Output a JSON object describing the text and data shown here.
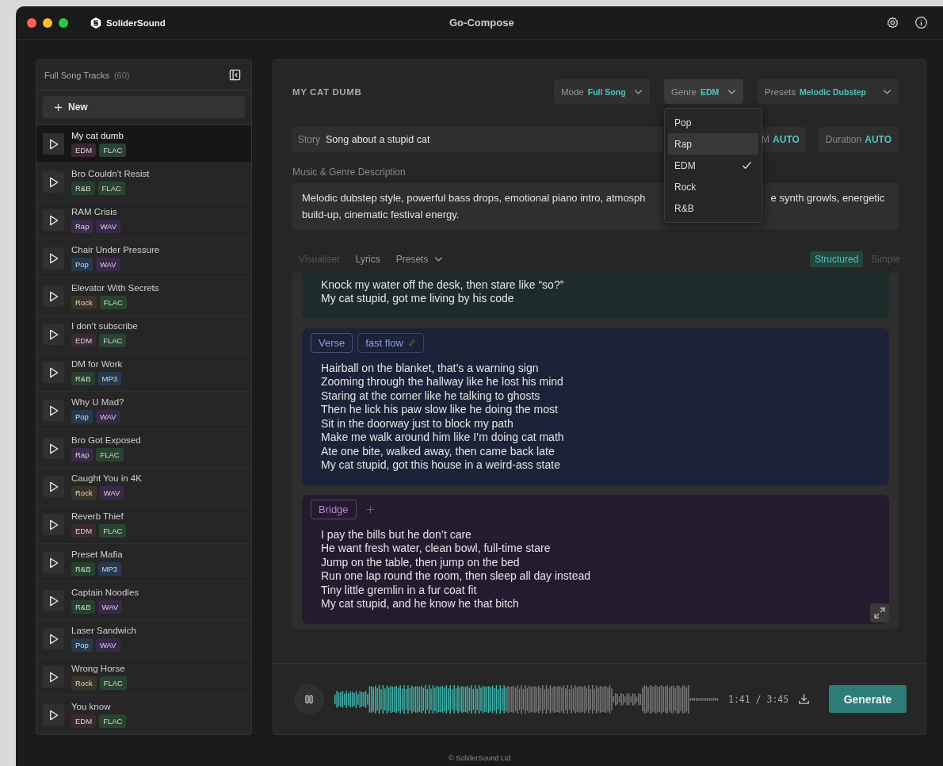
{
  "window": {
    "brand": "SoliderSound",
    "title": "Go-Compose"
  },
  "sidebar": {
    "title": "Full Song Tracks",
    "count": "(60)",
    "new_button": "New",
    "tracks": [
      {
        "name": "My cat dumb",
        "selected": true,
        "tags": [
          {
            "label": "EDM",
            "color": "#3a2833"
          },
          {
            "label": "FLAC",
            "color": "#284430"
          }
        ]
      },
      {
        "name": "Bro Couldn’t Resist",
        "selected": false,
        "tags": [
          {
            "label": "R&B",
            "color": "#27402e"
          },
          {
            "label": "FLAC",
            "color": "#284430"
          }
        ]
      },
      {
        "name": "RAM Crisis",
        "selected": false,
        "tags": [
          {
            "label": "Rap",
            "color": "#3a2b4b"
          },
          {
            "label": "WAV",
            "color": "#38294a"
          }
        ]
      },
      {
        "name": "Chair Under Pressure",
        "selected": false,
        "tags": [
          {
            "label": "Pop",
            "color": "#263a4f"
          },
          {
            "label": "WAV",
            "color": "#38294a"
          }
        ]
      },
      {
        "name": "Elevator With Secrets",
        "selected": false,
        "tags": [
          {
            "label": "Rock",
            "color": "#3a3427"
          },
          {
            "label": "FLAC",
            "color": "#284430"
          }
        ]
      },
      {
        "name": "I don’t subscribe",
        "selected": false,
        "tags": [
          {
            "label": "EDM",
            "color": "#3a2833"
          },
          {
            "label": "FLAC",
            "color": "#284430"
          }
        ]
      },
      {
        "name": "DM for Work",
        "selected": false,
        "tags": [
          {
            "label": "R&B",
            "color": "#27402e"
          },
          {
            "label": "MP3",
            "color": "#263a4f"
          }
        ]
      },
      {
        "name": "Why U Mad?",
        "selected": false,
        "tags": [
          {
            "label": "Pop",
            "color": "#263a4f"
          },
          {
            "label": "WAV",
            "color": "#38294a"
          }
        ]
      },
      {
        "name": "Bro Got Exposed",
        "selected": false,
        "tags": [
          {
            "label": "Rap",
            "color": "#3a2b4b"
          },
          {
            "label": "FLAC",
            "color": "#284430"
          }
        ]
      },
      {
        "name": "Caught You in 4K",
        "selected": false,
        "tags": [
          {
            "label": "Rock",
            "color": "#3a3427"
          },
          {
            "label": "WAV",
            "color": "#38294a"
          }
        ]
      },
      {
        "name": "Reverb Thief",
        "selected": false,
        "tags": [
          {
            "label": "EDM",
            "color": "#3a2833"
          },
          {
            "label": "FLAC",
            "color": "#284430"
          }
        ]
      },
      {
        "name": "Preset Mafia",
        "selected": false,
        "tags": [
          {
            "label": "R&B",
            "color": "#27402e"
          },
          {
            "label": "MP3",
            "color": "#263a4f"
          }
        ]
      },
      {
        "name": "Captain Noodles",
        "selected": false,
        "tags": [
          {
            "label": "R&B",
            "color": "#27402e"
          },
          {
            "label": "WAV",
            "color": "#38294a"
          }
        ]
      },
      {
        "name": "Laser Sandwich",
        "selected": false,
        "tags": [
          {
            "label": "Pop",
            "color": "#263a4f"
          },
          {
            "label": "WAV",
            "color": "#38294a"
          }
        ]
      },
      {
        "name": "Wrong Horse",
        "selected": false,
        "tags": [
          {
            "label": "Rock",
            "color": "#3a3427"
          },
          {
            "label": "FLAC",
            "color": "#284430"
          }
        ]
      },
      {
        "name": "You know",
        "selected": false,
        "tags": [
          {
            "label": "EDM",
            "color": "#3a2833"
          },
          {
            "label": "FLAC",
            "color": "#284430"
          }
        ]
      }
    ]
  },
  "composer": {
    "title": "MY CAT DUMB",
    "selectors": [
      {
        "label": "Mode",
        "value": "Full Song"
      },
      {
        "label": "Genre",
        "value": "EDM",
        "open": true,
        "options": [
          {
            "label": "Pop",
            "selected": false,
            "highlighted": false
          },
          {
            "label": "Rap",
            "selected": false,
            "highlighted": true
          },
          {
            "label": "EDM",
            "selected": true,
            "highlighted": false
          },
          {
            "label": "Rock",
            "selected": false,
            "highlighted": false
          },
          {
            "label": "R&B",
            "selected": false,
            "highlighted": false
          }
        ]
      },
      {
        "label": "Presets",
        "value": "Melodic Dubstep"
      }
    ],
    "story": {
      "label": "Story",
      "value": "Song about a stupid cat"
    },
    "settings": [
      {
        "label": "M",
        "value": "AUTO"
      },
      {
        "label": "Duration",
        "value": "AUTO"
      }
    ],
    "description": {
      "label": "Music & Genre Description",
      "text_before": "Melodic dubstep style, powerful bass drops, emotional piano intro, atmosph",
      "text_after": "e synth growls, energetic build-up, cinematic festival energy."
    },
    "tabs": [
      {
        "label": "Visualiser",
        "kind": "tab",
        "disabled": true
      },
      {
        "label": "Lyrics",
        "kind": "tab",
        "disabled": false
      },
      {
        "label": "Presets",
        "kind": "dropdown",
        "disabled": false
      }
    ],
    "view_modes": [
      {
        "label": "Structured",
        "selected": true
      },
      {
        "label": "Simple",
        "selected": false
      }
    ],
    "sections": [
      {
        "color": "#1e2b2b",
        "lines": [
          "Knock my water off the desk, then stare like “so?”",
          "My cat stupid, got me living by his code"
        ]
      },
      {
        "color": "#1c2238",
        "tag": {
          "label": "Verse",
          "color": "#8a9ce2"
        },
        "note": "fast flow",
        "lines": [
          "Hairball on the blanket, that’s a warning sign",
          "Zooming through the hallway like he lost his mind",
          "Staring at the corner like he talking to ghosts",
          "Then he lick his paw slow like he doing the most",
          "Sit in the doorway just to block my path",
          "Make me walk around him like I’m doing cat math",
          "Ate one bite, walked away, then came back late",
          "My cat stupid, got this house in a weird-ass state"
        ]
      },
      {
        "color": "#241b2e",
        "tag": {
          "label": "Bridge",
          "color": "#b781d6"
        },
        "lines": [
          "I pay the bills but he don’t care",
          "He want fresh water, clean bowl, full-time stare",
          "Jump on the table, then jump on the bed",
          "Run one lap round the room, then sleep all day instead",
          "Tiny little gremlin in a fur coat fit",
          "My cat stupid, and he know he that bitch"
        ]
      }
    ],
    "player": {
      "playing": true,
      "level": 0.45,
      "time": "1:41 / 3:45",
      "generate_button": "Generate"
    }
  },
  "footer": "© SoliderSound Ltd"
}
